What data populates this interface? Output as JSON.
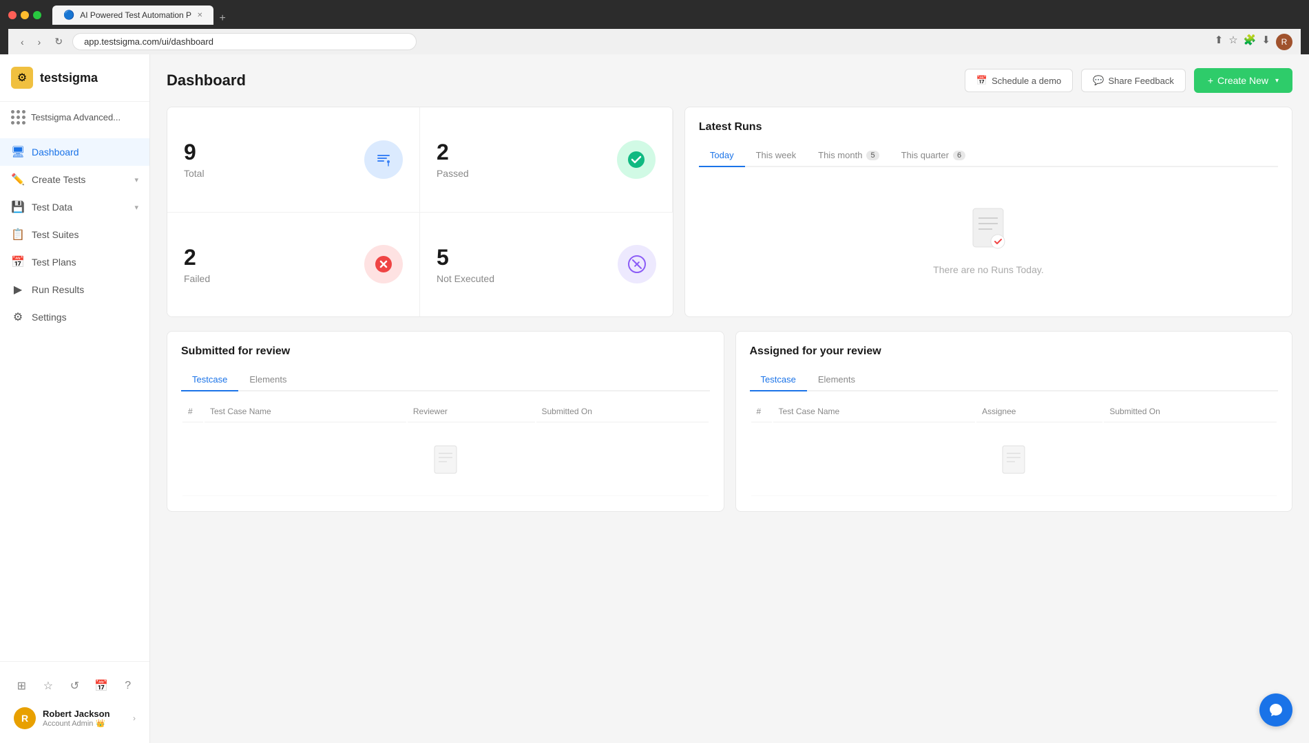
{
  "browser": {
    "tab_title": "AI Powered Test Automation P",
    "url": "app.testsigma.com/ui/dashboard"
  },
  "logo": {
    "text": "testsigma"
  },
  "workspace": {
    "label": "Testsigma Advanced..."
  },
  "nav": {
    "items": [
      {
        "id": "dashboard",
        "label": "Dashboard",
        "icon": "🖥",
        "active": true,
        "has_chevron": false
      },
      {
        "id": "create-tests",
        "label": "Create Tests",
        "icon": "✏️",
        "active": false,
        "has_chevron": true
      },
      {
        "id": "test-data",
        "label": "Test Data",
        "icon": "💾",
        "active": false,
        "has_chevron": true
      },
      {
        "id": "test-suites",
        "label": "Test Suites",
        "icon": "📋",
        "active": false,
        "has_chevron": false
      },
      {
        "id": "test-plans",
        "label": "Test Plans",
        "icon": "📅",
        "active": false,
        "has_chevron": false
      },
      {
        "id": "run-results",
        "label": "Run Results",
        "icon": "▶",
        "active": false,
        "has_chevron": false
      },
      {
        "id": "settings",
        "label": "Settings",
        "icon": "⚙",
        "active": false,
        "has_chevron": false
      }
    ]
  },
  "user": {
    "name": "Robert Jackson",
    "role": "Account Admin",
    "avatar_letter": "R"
  },
  "header": {
    "title": "Dashboard",
    "schedule_label": "Schedule a demo",
    "feedback_label": "Share Feedback",
    "create_label": "Create New"
  },
  "stats": {
    "total": {
      "number": "9",
      "label": "Total"
    },
    "passed": {
      "number": "2",
      "label": "Passed"
    },
    "failed": {
      "number": "2",
      "label": "Failed"
    },
    "not_executed": {
      "number": "5",
      "label": "Not Executed"
    }
  },
  "latest_runs": {
    "title": "Latest Runs",
    "tabs": [
      {
        "id": "today",
        "label": "Today",
        "badge": null,
        "active": true
      },
      {
        "id": "this-week",
        "label": "This week",
        "badge": null,
        "active": false
      },
      {
        "id": "this-month",
        "label": "This month",
        "badge": "5",
        "active": false
      },
      {
        "id": "this-quarter",
        "label": "This quarter",
        "badge": "6",
        "active": false
      }
    ],
    "empty_message": "There are no Runs Today."
  },
  "submitted_for_review": {
    "title": "Submitted for review",
    "tabs": [
      {
        "label": "Testcase",
        "active": true
      },
      {
        "label": "Elements",
        "active": false
      }
    ],
    "columns": [
      "#",
      "Test Case Name",
      "Reviewer",
      "Submitted On"
    ]
  },
  "assigned_for_review": {
    "title": "Assigned for your review",
    "tabs": [
      {
        "label": "Testcase",
        "active": true
      },
      {
        "label": "Elements",
        "active": false
      }
    ],
    "columns": [
      "#",
      "Test Case Name",
      "Assignee",
      "Submitted On"
    ]
  }
}
